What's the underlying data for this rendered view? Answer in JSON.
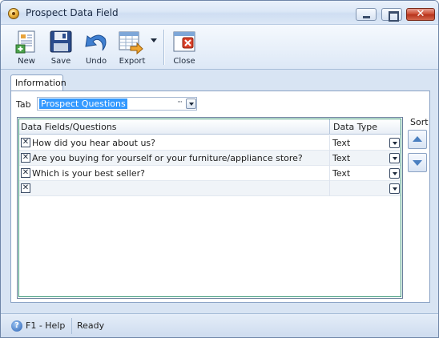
{
  "window": {
    "title": "Prospect Data Field"
  },
  "toolbar": {
    "new_label": "New",
    "save_label": "Save",
    "undo_label": "Undo",
    "export_label": "Export",
    "close_label": "Close"
  },
  "tabs": [
    {
      "label": "Information",
      "selected": true
    }
  ],
  "form": {
    "tab_label": "Tab",
    "tab_value": "Prospect Questions"
  },
  "grid": {
    "columns": [
      "Data Fields/Questions",
      "Data Type"
    ],
    "rows": [
      {
        "question": "How did you hear about us?",
        "type": "Text"
      },
      {
        "question": "Are you buying for yourself or your furniture/appliance store?",
        "type": "Text"
      },
      {
        "question": "Which is your best seller?",
        "type": "Text"
      },
      {
        "question": "",
        "type": ""
      }
    ]
  },
  "sort": {
    "label": "Sort"
  },
  "status": {
    "help": "F1 - Help",
    "state": "Ready"
  },
  "icons": {
    "app": "app-logo-icon",
    "new": "new-document-icon",
    "save": "floppy-disk-icon",
    "undo": "undo-arrow-icon",
    "export": "spreadsheet-export-icon",
    "close": "close-window-icon",
    "help": "help-question-icon"
  }
}
